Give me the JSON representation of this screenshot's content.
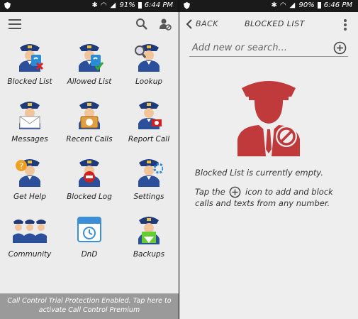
{
  "left_screen": {
    "status": {
      "battery": "91%",
      "time": "6:44 PM"
    },
    "grid": [
      {
        "label": "Blocked List",
        "icon": "officer-phone-blocked-icon"
      },
      {
        "label": "Allowed List",
        "icon": "officer-phone-allowed-icon"
      },
      {
        "label": "Lookup",
        "icon": "officer-magnifier-icon"
      },
      {
        "label": "Messages",
        "icon": "officer-envelope-icon"
      },
      {
        "label": "Recent Calls",
        "icon": "officer-calls-icon"
      },
      {
        "label": "Report Call",
        "icon": "officer-red-phone-icon"
      },
      {
        "label": "Get Help",
        "icon": "officer-question-icon"
      },
      {
        "label": "Blocked Log",
        "icon": "officer-stop-icon"
      },
      {
        "label": "Settings",
        "icon": "officer-gear-icon"
      },
      {
        "label": "Community",
        "icon": "officer-group-icon"
      },
      {
        "label": "DnD",
        "icon": "calendar-clock-icon"
      },
      {
        "label": "Backups",
        "icon": "officer-download-icon"
      }
    ],
    "promo": "Call Control Trial Protection Enabled. Tap here to activate Call Control Premium"
  },
  "right_screen": {
    "status": {
      "battery": "90%",
      "time": "6:46 PM"
    },
    "back_label": "BACK",
    "title": "BLOCKED LIST",
    "search_placeholder": "Add new or search...",
    "empty_title": "Blocked List is currently empty.",
    "empty_pre": "Tap the",
    "empty_post": "icon to add and block calls and texts from any number."
  },
  "colors": {
    "accent_red": "#c0393b",
    "promo_bg": "#9a9a9a"
  }
}
